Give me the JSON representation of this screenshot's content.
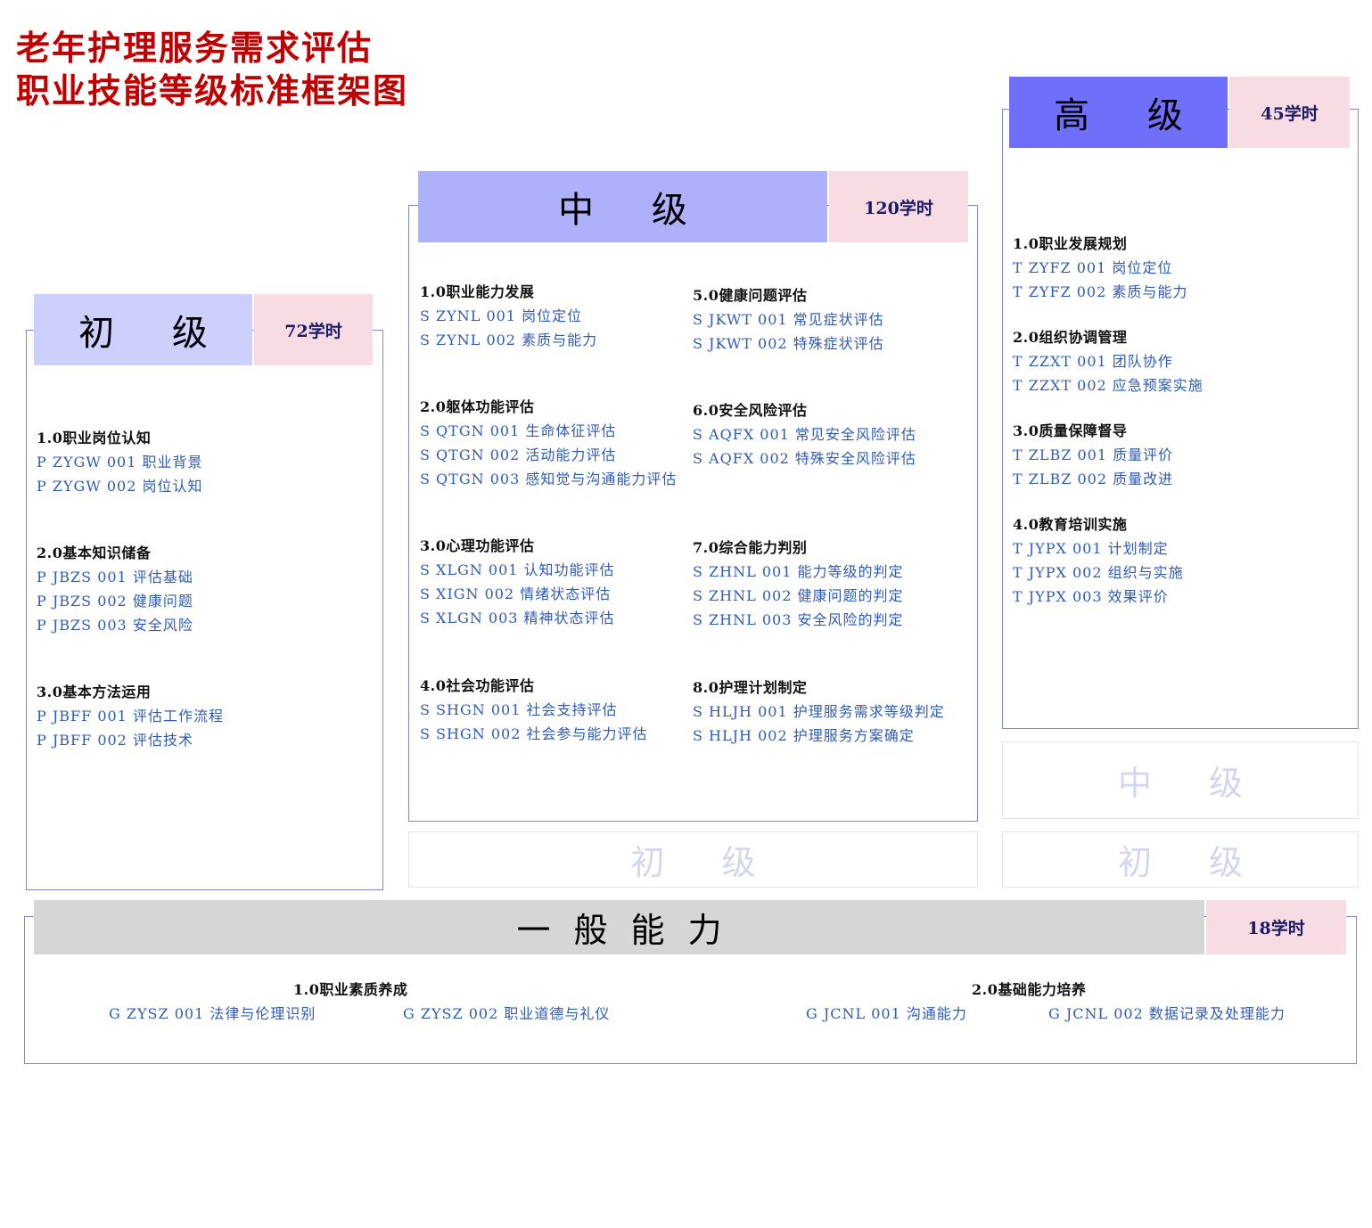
{
  "title": [
    "老年护理服务需求评估",
    "职业技能等级标准框架图"
  ],
  "colors": {
    "title": "#c00000",
    "advanced_header": "#6f6ffb",
    "intermediate_header": "#aeb0fb",
    "primary_header": "#cdd0fd",
    "general_header": "#d6d6d6",
    "hours_bg": "#f8dce3",
    "item_text": "#2e5bb8",
    "border": "#7f86e6"
  },
  "advanced": {
    "name": "高 级",
    "hours": "45学时",
    "groups": [
      {
        "title": "1.0职业发展规划",
        "items": [
          "T ZYFZ 001 岗位定位",
          "T ZYFZ 002 素质与能力"
        ]
      },
      {
        "title": "2.0组织协调管理",
        "items": [
          "T ZZXT 001 团队协作",
          "T ZZXT 002 应急预案实施"
        ]
      },
      {
        "title": "3.0质量保障督导",
        "items": [
          "T ZLBZ 001 质量评价",
          "T ZLBZ 002 质量改进"
        ]
      },
      {
        "title": "4.0教育培训实施",
        "items": [
          "T JYPX 001 计划制定",
          "T JYPX 002 组织与实施",
          "T JYPX 003 效果评价"
        ]
      }
    ],
    "ghost_levels": [
      "中 级",
      "初 级"
    ]
  },
  "intermediate": {
    "name": "中 级",
    "hours": "120学时",
    "groups": [
      {
        "title": "1.0职业能力发展",
        "items": [
          "S ZYNL 001 岗位定位",
          "S ZYNL 002 素质与能力"
        ]
      },
      {
        "title": "2.0躯体功能评估",
        "items": [
          "S QTGN 001 生命体征评估",
          "S QTGN 002 活动能力评估",
          "S QTGN 003 感知觉与沟通能力评估"
        ]
      },
      {
        "title": "3.0心理功能评估",
        "items": [
          "S XLGN 001 认知功能评估",
          "S XIGN  002 情绪状态评估",
          "S XLGN 003 精神状态评估"
        ]
      },
      {
        "title": "4.0社会功能评估",
        "items": [
          "S SHGN 001 社会支持评估",
          "S SHGN 002 社会参与能力评估"
        ]
      },
      {
        "title": "5.0健康问题评估",
        "items": [
          "S JKWT 001 常见症状评估",
          "S JKWT 002 特殊症状评估"
        ]
      },
      {
        "title": "6.0安全风险评估",
        "items": [
          "S AQFX 001 常见安全风险评估",
          "S AQFX 002 特殊安全风险评估"
        ]
      },
      {
        "title": "7.0综合能力判别",
        "items": [
          "S ZHNL 001 能力等级的判定",
          "S ZHNL 002 健康问题的判定",
          "S ZHNL 003 安全风险的判定"
        ]
      },
      {
        "title": "8.0护理计划制定",
        "items": [
          "S HLJH 001 护理服务需求等级判定",
          "S HLJH 002 护理服务方案确定"
        ]
      }
    ],
    "ghost_levels": [
      "初 级"
    ]
  },
  "primary": {
    "name": "初 级",
    "hours": "72学时",
    "groups": [
      {
        "title": "1.0职业岗位认知",
        "items": [
          "P ZYGW 001 职业背景",
          "P ZYGW 002 岗位认知"
        ]
      },
      {
        "title": "2.0基本知识储备",
        "items": [
          "P JBZS 001 评估基础",
          "P JBZS 002 健康问题",
          "P JBZS 003 安全风险"
        ]
      },
      {
        "title": "3.0基本方法运用",
        "items": [
          "P JBFF 001 评估工作流程",
          "P JBFF 002 评估技术"
        ]
      }
    ]
  },
  "general": {
    "name": "一般能力",
    "hours": "18学时",
    "groups": [
      {
        "title": "1.0职业素质养成",
        "items": [
          "G ZYSZ 001 法律与伦理识别",
          "G ZYSZ 002 职业道德与礼仪"
        ]
      },
      {
        "title": "2.0基础能力培养",
        "items": [
          "G JCNL 001 沟通能力",
          "G JCNL 002 数据记录及处理能力"
        ]
      }
    ]
  }
}
